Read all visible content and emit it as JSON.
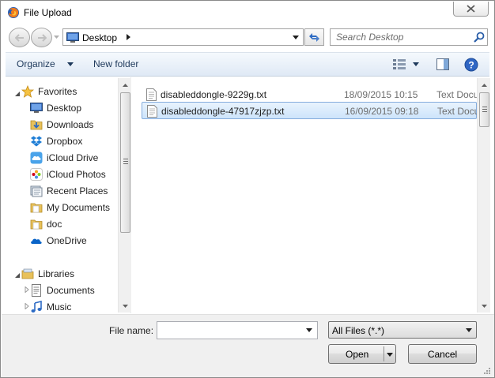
{
  "window": {
    "title": "File Upload"
  },
  "address": {
    "location": "Desktop"
  },
  "search": {
    "placeholder": "Search Desktop"
  },
  "toolbar": {
    "organize_label": "Organize",
    "new_folder_label": "New folder"
  },
  "sidebar": {
    "favorites_label": "Favorites",
    "favorites": [
      {
        "label": "Desktop",
        "icon": "desktop-icon"
      },
      {
        "label": "Downloads",
        "icon": "downloads-icon"
      },
      {
        "label": "Dropbox",
        "icon": "dropbox-icon"
      },
      {
        "label": "iCloud Drive",
        "icon": "icloud-drive-icon"
      },
      {
        "label": "iCloud Photos",
        "icon": "icloud-photos-icon"
      },
      {
        "label": "Recent Places",
        "icon": "recent-places-icon"
      },
      {
        "label": "My Documents",
        "icon": "folder-icon"
      },
      {
        "label": "doc",
        "icon": "folder-icon"
      },
      {
        "label": "OneDrive",
        "icon": "onedrive-icon"
      }
    ],
    "libraries_label": "Libraries",
    "libraries": [
      {
        "label": "Documents",
        "icon": "documents-library-icon"
      },
      {
        "label": "Music",
        "icon": "music-library-icon"
      }
    ]
  },
  "files": [
    {
      "name": "disableddongle-9229g.txt",
      "date": "18/09/2015 10:15",
      "type": "Text Document",
      "selected": false
    },
    {
      "name": "disableddongle-47917zjzp.txt",
      "date": "16/09/2015 09:18",
      "type": "Text Document",
      "selected": true
    }
  ],
  "bottom": {
    "file_name_label": "File name:",
    "file_name_value": "",
    "filter_value": "All Files (*.*)",
    "open_label": "Open",
    "cancel_label": "Cancel"
  },
  "colors": {
    "toolbar_text": "#1e395b",
    "selection_border": "#84acdd",
    "selection_fill": "#cde4fb"
  }
}
